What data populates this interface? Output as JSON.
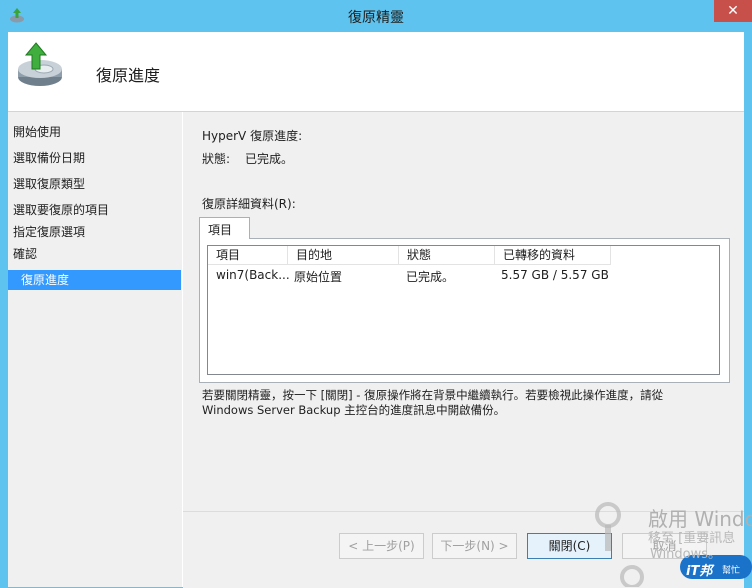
{
  "window": {
    "title": "復原精靈",
    "close_glyph": "✕"
  },
  "header": {
    "title": "復原進度",
    "icon": "backup-restore-icon"
  },
  "sidebar": {
    "items": [
      {
        "label": "開始使用",
        "selected": false
      },
      {
        "label": "選取備份日期",
        "selected": false
      },
      {
        "label": "選取復原類型",
        "selected": false
      },
      {
        "label": "選取要復原的項目",
        "selected": false
      },
      {
        "label": "指定復原選項",
        "selected": false
      },
      {
        "label": "確認",
        "selected": false
      },
      {
        "label": "復原進度",
        "selected": true
      }
    ]
  },
  "main": {
    "progress_heading": "HyperV 復原進度:",
    "status_label": "狀態:",
    "status_value": "已完成。",
    "details_label": "復原詳細資料(R):",
    "tab_label": "項目",
    "table": {
      "columns": [
        "項目",
        "目的地",
        "狀態",
        "已轉移的資料"
      ],
      "rows": [
        [
          "win7(Back...",
          "原始位置",
          "已完成。",
          "5.57 GB / 5.57 GB"
        ]
      ]
    },
    "info_line1": "若要關閉精靈，按一下 [關閉] - 復原操作將在背景中繼續執行。若要檢視此操作進度，請從",
    "info_line2": "Windows Server Backup 主控台的進度訊息中開啟備份。"
  },
  "footer": {
    "prev_label": "< 上一步(P)",
    "next_label": "下一步(N) >",
    "close_label": "關閉(C)",
    "cancel_label": "取消"
  },
  "watermark": {
    "line1": "啟用 Windo",
    "line2": "移至 [重要訊息",
    "line3": "Windows。",
    "logo_text": "iT邦",
    "logo_sub": "幫忙"
  }
}
